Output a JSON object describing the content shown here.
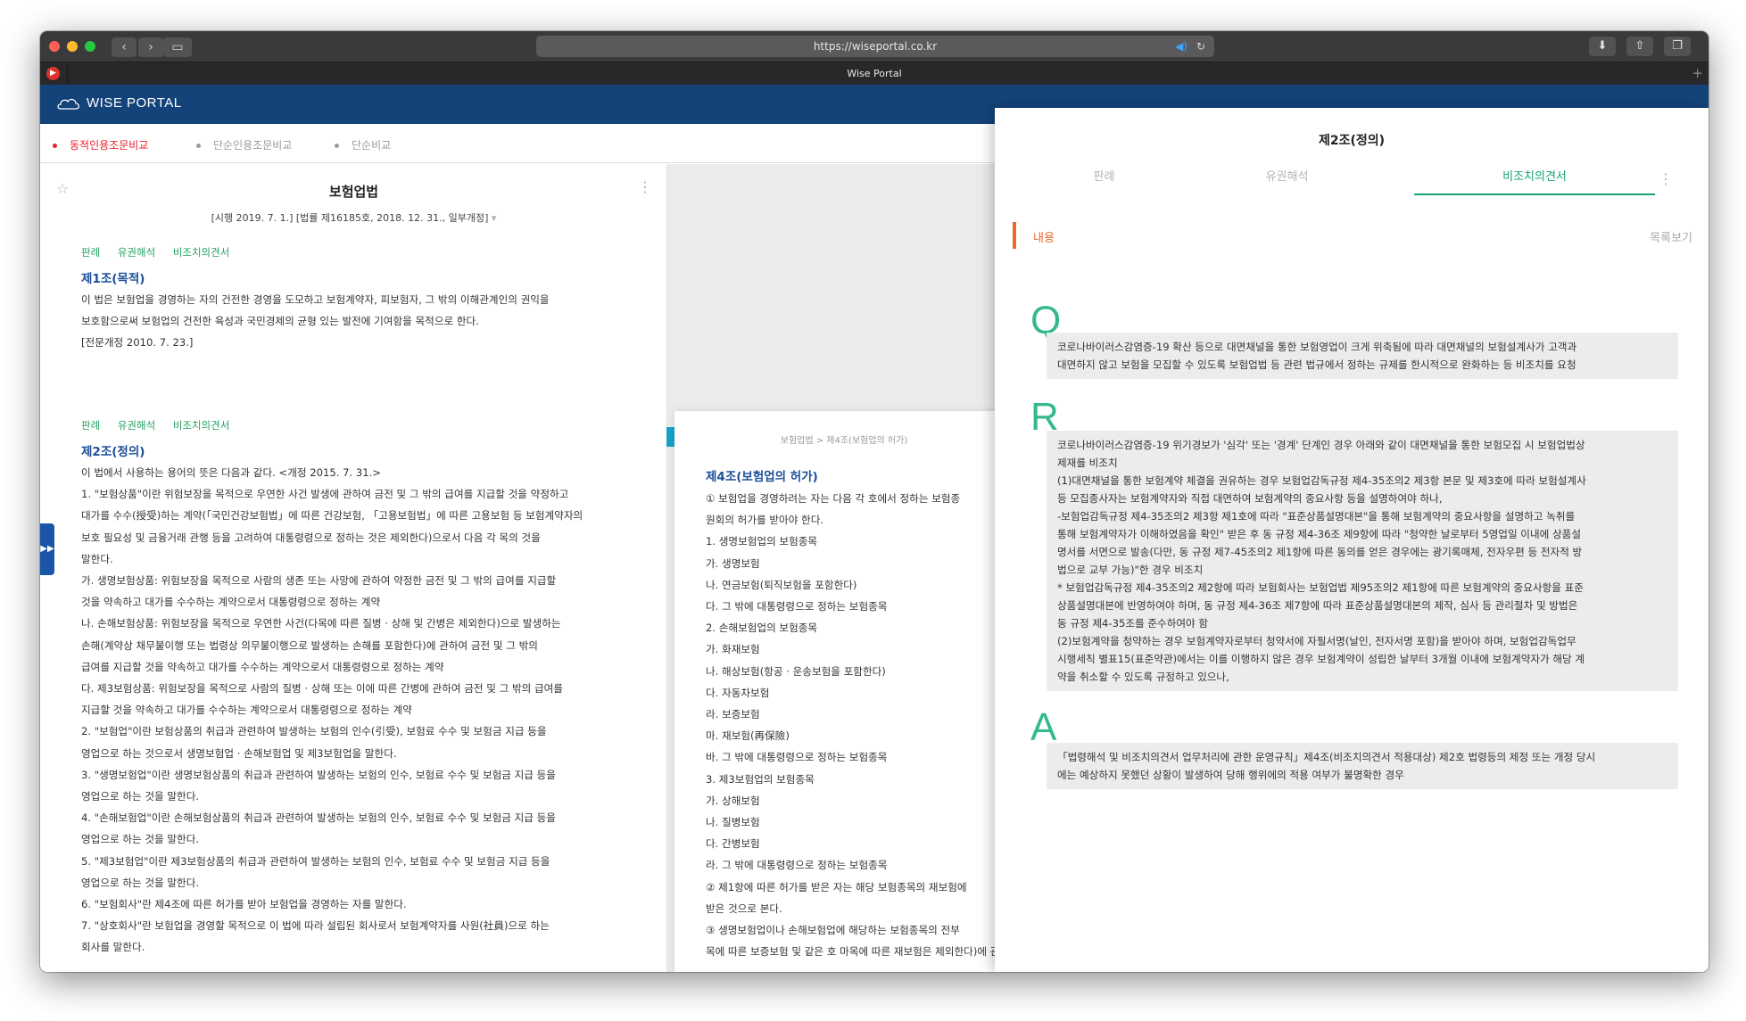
{
  "browser": {
    "url": "https://wiseportal.co.kr",
    "tab_title": "Wise Portal"
  },
  "header": {
    "logo": "WISE PORTAL"
  },
  "mode_tabs": [
    {
      "label": "동적인용조문비교",
      "active": true
    },
    {
      "label": "단순인용조문비교",
      "active": false
    },
    {
      "label": "단순비교",
      "active": false
    }
  ],
  "left": {
    "title": "보험업법",
    "meta": "[시행 2019. 7. 1.] [법률 제16185호, 2018. 12. 31., 일부개정]",
    "tags1": [
      "판례",
      "유권해석",
      "비조치의견서"
    ],
    "art1_head": "제1조(목적)",
    "art1_lines": [
      "이 법은 보험업을 경영하는 자의 건전한 경영을 도모하고 보험계약자, 피보험자, 그 밖의 이해관계인의 권익을",
      "보호함으로써 보험업의 건전한 육성과 국민경제의 균형 있는 발전에 기여함을 목적으로 한다.",
      "[전문개정 2010. 7. 23.]"
    ],
    "tags2": [
      "판례",
      "유권해석",
      "비조치의견서"
    ],
    "art2_head": "제2조(정의)",
    "art2_lines": [
      "이 법에서 사용하는 용어의 뜻은 다음과 같다. <개정 2015. 7. 31.>",
      "1. \"보험상품\"이란 위험보장을 목적으로 우연한 사건 발생에 관하여 금전 및 그 밖의 급여를 지급할 것을 약정하고",
      "대가를 수수(授受)하는 계약(「국민건강보험법」에 따른 건강보험, 「고용보험법」에 따른 고용보험 등 보험계약자의",
      "보호 필요성 및 금융거래 관행 등을 고려하여 대통령령으로 정하는 것은 제외한다)으로서 다음 각 목의 것을",
      "말한다.",
      "가. 생명보험상품: 위험보장을 목적으로 사람의 생존 또는 사망에 관하여 약정한 금전 및 그 밖의 급여를 지급할",
      "것을 약속하고 대가를 수수하는 계약으로서 대통령령으로 정하는 계약",
      "나. 손해보험상품: 위험보장을 목적으로 우연한 사건(다목에 따른 질병 · 상해 및 간병은 제외한다)으로 발생하는",
      "손해(계약상 채무불이행 또는 법령상 의무불이행으로 발생하는 손해를 포함한다)에 관하여 금전 및 그 밖의",
      "급여를 지급할 것을 약속하고 대가를 수수하는 계약으로서 대통령령으로 정하는 계약",
      "다. 제3보험상품: 위험보장을 목적으로 사람의 질병 · 상해 또는 이에 따른 간병에 관하여 금전 및 그 밖의 급여를",
      "지급할 것을 약속하고 대가를 수수하는 계약으로서 대통령령으로 정하는 계약",
      "2. \"보험업\"이란 보험상품의 취급과 관련하여 발생하는 보험의 인수(引受), 보험료 수수 및 보험금 지급 등을",
      "영업으로 하는 것으로서 생명보험업 · 손해보험업 및 제3보험업을 말한다.",
      "3. \"생명보험업\"이란 생명보험상품의 취급과 관련하여 발생하는 보험의 인수, 보험료 수수 및 보험금 지급 등을",
      "영업으로 하는 것을 말한다.",
      "4. \"손해보험업\"이란 손해보험상품의 취급과 관련하여 발생하는 보험의 인수, 보험료 수수 및 보험금 지급 등을",
      "영업으로 하는 것을 말한다.",
      "5. \"제3보험업\"이란 제3보험상품의 취급과 관련하여 발생하는 보험의 인수, 보험료 수수 및 보험금 지급 등을",
      "영업으로 하는 것을 말한다.",
      "6. \"보험회사\"란 제4조에 따른 허가를 받아 보험업을 경영하는 자를 말한다.",
      "7. \"상호회사\"란 보험업을 경영할 목적으로 이 법에 따라 설립된 회사로서 보험계약자를 사원(社員)으로 하는",
      "회사를 말한다."
    ]
  },
  "middle": {
    "breadcrumb": "보험업법 > 제4조(보험업의 허가)",
    "head": "제4조(보험업의 허가)",
    "lines": [
      "① 보험업을 경영하려는 자는 다음 각 호에서 정하는 보험종",
      "원회의 허가를 받아야 한다.",
      "1. 생명보험업의 보험종목",
      "가. 생명보험",
      "나. 연금보험(퇴직보험을 포함한다)",
      "다. 그 밖에 대통령령으로 정하는 보험종목",
      "2. 손해보험업의 보험종목",
      "가. 화재보험",
      "나. 해상보험(항공 · 운송보험을 포함한다)",
      "다. 자동차보험",
      "라. 보증보험",
      "마. 재보험(再保險)",
      "바. 그 밖에 대통령령으로 정하는 보험종목",
      "3. 제3보험업의 보험종목",
      "가. 상해보험",
      "나. 질병보험",
      "다. 간병보험",
      "라. 그 밖에 대통령령으로 정하는 보험종목",
      "② 제1항에 따른 허가를 받은 자는 해당 보험종목의 재보험에",
      "받은 것으로 본다.",
      "③ 생명보험업이나 손해보험업에 해당하는 보험종목의 전부",
      "목에 따른 보증보험 및 같은 호 마목에 따른 재보험은 제외한다)에 관하여"
    ]
  },
  "right": {
    "title": "제2조(정의)",
    "tabs": [
      {
        "label": "판례",
        "active": false
      },
      {
        "label": "유권해석",
        "active": false
      },
      {
        "label": "비조치의견서",
        "active": true
      }
    ],
    "content_label": "내용",
    "list_label": "목록보기",
    "q_letter": "Q",
    "q_lines": [
      "코로나바이러스감염증-19 확산 등으로 대면채널을 통한 보험영업이 크게 위축됨에 따라 대면채널의 보험설계사가 고객과",
      "대면하지 않고 보험을 모집할 수 있도록 보험업법 등 관련 법규에서 정하는 규제를 한시적으로 완화하는 등 비조치를 요청"
    ],
    "r_letter": "R",
    "r_lines": [
      "코로나바이러스감염증-19 위기경보가 '심각' 또는 '경계' 단계인 경우 아래와 같이 대면채널을 통한 보험모집 시 보험업법상",
      "제재를 비조치",
      "(1)대면채널을 통한 보험계약 체결을 권유하는 경우 보험업감독규정 제4-35조의2 제3항 본문 및 제3호에 따라 보험설계사",
      "등 모집종사자는 보험계약자와 직접 대면하여 보험계약의 중요사항 등을 설명하여야 하나,",
      "-보험업감독규정 제4-35조의2 제3항 제1호에 따라 \"표준상품설명대본\"을 통해 보험계약의 중요사항을 설명하고 녹취를",
      "통해 보험계약자가 이해하였음을 확인\" 받은 후 동 규정 제4-36조 제9항에 따라 \"청약한 날로부터 5영업일 이내에 상품설",
      "명서를 서면으로 발송(다만, 동 규정 제7-45조의2 제1항에 따른 동의를 얻은 경우에는 광기록매체, 전자우편 등 전자적 방",
      "법으로 교부 가능)\"한 경우 비조치",
      "* 보험업감독규정 제4-35조의2 제2항에 따라 보험회사는 보험업법 제95조의2 제1항에 따른 보험계약의 중요사항을 표준",
      "상품설명대본에 반영하여야 하며, 동 규정 제4-36조 제7항에 따라 표준상품설명대본의 제작, 심사 등 관리절차 및 방법은",
      "동 규정 제4-35조를 준수하여야 함",
      "(2)보험계약을 청약하는 경우 보험계약자로부터 청약서에 자필서명(날인, 전자서명 포함)을 받아야 하며, 보험업감독업무",
      "시행세칙 별표15(표준약관)에서는 이를 이행하지 않은 경우 보험계약이 성립한 날부터 3개월 이내에 보험계약자가 해당 계",
      "약을 취소할 수 있도록 규정하고 있으나,"
    ],
    "a_letter": "A",
    "a_lines": [
      "「법령해석 및 비조치의견서 업무처리에 관한 운영규칙」제4조(비조치의견서 적용대상) 제2호 법령등의 제정 또는 개정 당시",
      "에는 예상하지 못했던 상황이 발생하여 당해 행위에의 적용 여부가 불명확한 경우"
    ]
  },
  "colors": {
    "header_bg": "#14437a",
    "accent_green": "#16a07a",
    "accent_red": "#e8212b",
    "accent_orange": "#e86a2a",
    "heading_blue": "#1c4f9a"
  },
  "icons": [
    "close-dot",
    "minimize-dot",
    "maximize-dot",
    "back-icon",
    "forward-icon",
    "sidebar-icon",
    "speaker-icon",
    "reload-icon",
    "download-icon",
    "share-icon",
    "tabs-icon",
    "star-icon",
    "kebab-icon",
    "expand-handle-icon"
  ]
}
